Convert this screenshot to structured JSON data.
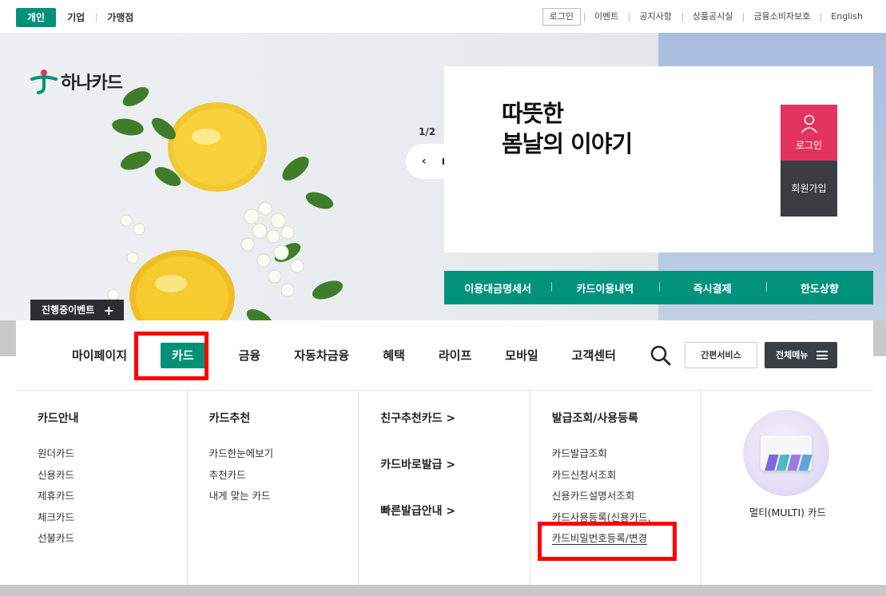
{
  "topbar": {
    "segments": [
      "개인",
      "기업",
      "가맹점"
    ],
    "login": "로그인",
    "links": [
      "이벤트",
      "공지사항",
      "상품공시실",
      "금융소비자보호",
      "English"
    ]
  },
  "hero": {
    "brand": "하나카드",
    "pager": "1/2",
    "controls": {
      "prev": "‹",
      "pause": "II",
      "next": "›"
    },
    "banner_title": "따뜻한\n봄날의 이야기",
    "login_button": "로그인",
    "join_button": "회원가입",
    "quick_links": [
      "이용대금명세서",
      "카드이용내역",
      "즉시결제",
      "한도상향"
    ],
    "event_button": "진행중이벤트",
    "event_plus": "+"
  },
  "gnb": {
    "menus": [
      "마이페이지",
      "카드",
      "금융",
      "자동차금융",
      "혜택",
      "라이프",
      "모바일",
      "고객센터"
    ],
    "simple_service": "간편서비스",
    "full_menu": "전체메뉴"
  },
  "mega": {
    "col1": {
      "head": "카드안내",
      "links": [
        "원더카드",
        "신용카드",
        "제휴카드",
        "체크카드",
        "선불카드"
      ]
    },
    "col2": {
      "head": "카드추천",
      "links": [
        "카드한눈에보기",
        "추천카드",
        "내게 맞는 카드"
      ]
    },
    "col3": {
      "heads": [
        "친구추천카드 >",
        "카드바로발급 >",
        "빠른발급안내 >"
      ]
    },
    "col4": {
      "head": "발급조회/사용등록",
      "links": [
        "카드발급조회",
        "카드신청서조회",
        "신용카드설명서조회",
        "카드사용등록(신용카드,",
        "카드비밀번호등록/변경"
      ]
    },
    "col5": {
      "label": "멀티(MULTI) 카드"
    }
  },
  "colors": {
    "accent": "#009178",
    "pink": "#e2345e",
    "dark": "#3a3e45",
    "highlight": "#ff0000"
  }
}
